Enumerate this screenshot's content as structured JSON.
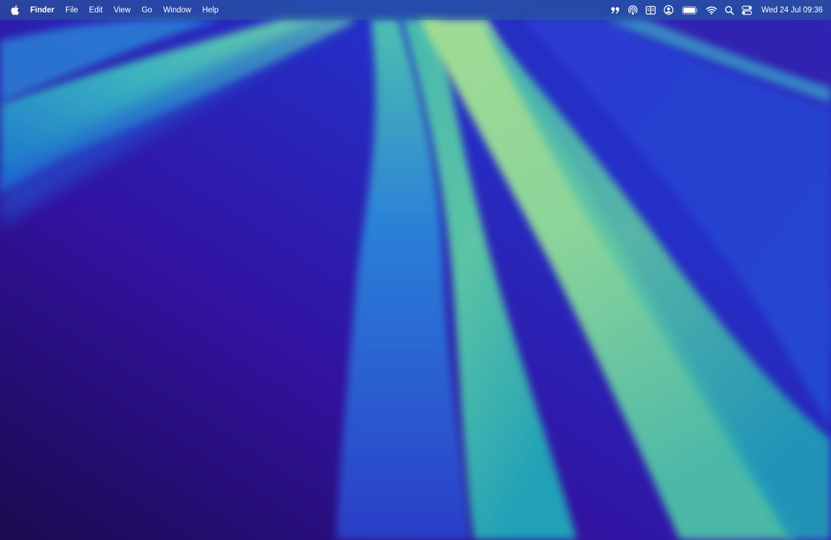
{
  "menubar": {
    "apple_icon": "apple-logo-icon",
    "app_name": "Finder",
    "menus": [
      "File",
      "Edit",
      "View",
      "Go",
      "Window",
      "Help"
    ],
    "status_icons": [
      "quote-icon",
      "airdrop-icon",
      "window-split-icon",
      "user-account-icon",
      "battery-icon",
      "wifi-icon",
      "spotlight-search-icon",
      "control-center-icon"
    ],
    "clock": "Wed 24 Jul  09:36"
  },
  "colors": {
    "menubar_bg": "#3a8fa0",
    "wallpaper_deep": "#1a0a5a",
    "wallpaper_blue": "#2a3fd0",
    "wallpaper_green": "#9ed99a",
    "wallpaper_teal": "#4fb8a8"
  }
}
